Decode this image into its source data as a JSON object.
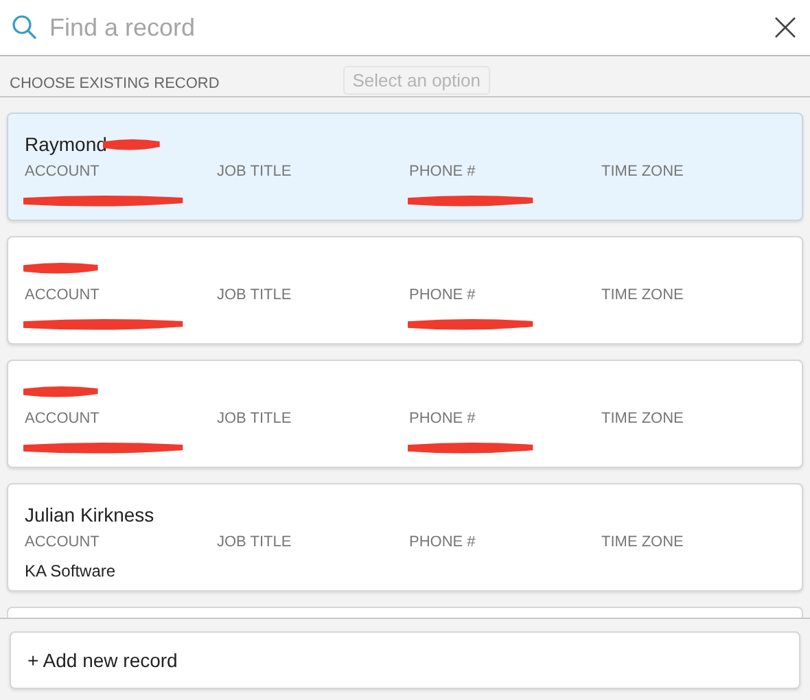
{
  "search": {
    "placeholder": "Find a record"
  },
  "section_title": "CHOOSE EXISTING RECORD",
  "background_hint": "Select an option",
  "records": [
    {
      "selected": true,
      "labels": [
        "ACCOUNT",
        "JOB TITLE",
        "PHONE #",
        "TIME ZONE"
      ],
      "name": {
        "text": "Raymond",
        "redacted": true
      },
      "account": {
        "redacted": true
      },
      "phone": {
        "redacted": true
      }
    },
    {
      "selected": false,
      "labels": [
        "ACCOUNT",
        "JOB TITLE",
        "PHONE #",
        "TIME ZONE"
      ],
      "name": {
        "redacted": true
      },
      "account": {
        "redacted": true
      },
      "phone": {
        "redacted": true
      }
    },
    {
      "selected": false,
      "labels": [
        "ACCOUNT",
        "JOB TITLE",
        "PHONE #",
        "TIME ZONE"
      ],
      "name": {
        "redacted": true
      },
      "account": {
        "redacted": true
      },
      "phone": {
        "redacted": true
      }
    },
    {
      "selected": false,
      "labels": [
        "ACCOUNT",
        "JOB TITLE",
        "PHONE #",
        "TIME ZONE"
      ],
      "name": {
        "text": "Julian Kirkness",
        "redacted": false
      },
      "account": {
        "text": "KA Software",
        "redacted": false
      },
      "phone": {
        "redacted": false
      }
    }
  ],
  "add_button": "+ Add new record"
}
